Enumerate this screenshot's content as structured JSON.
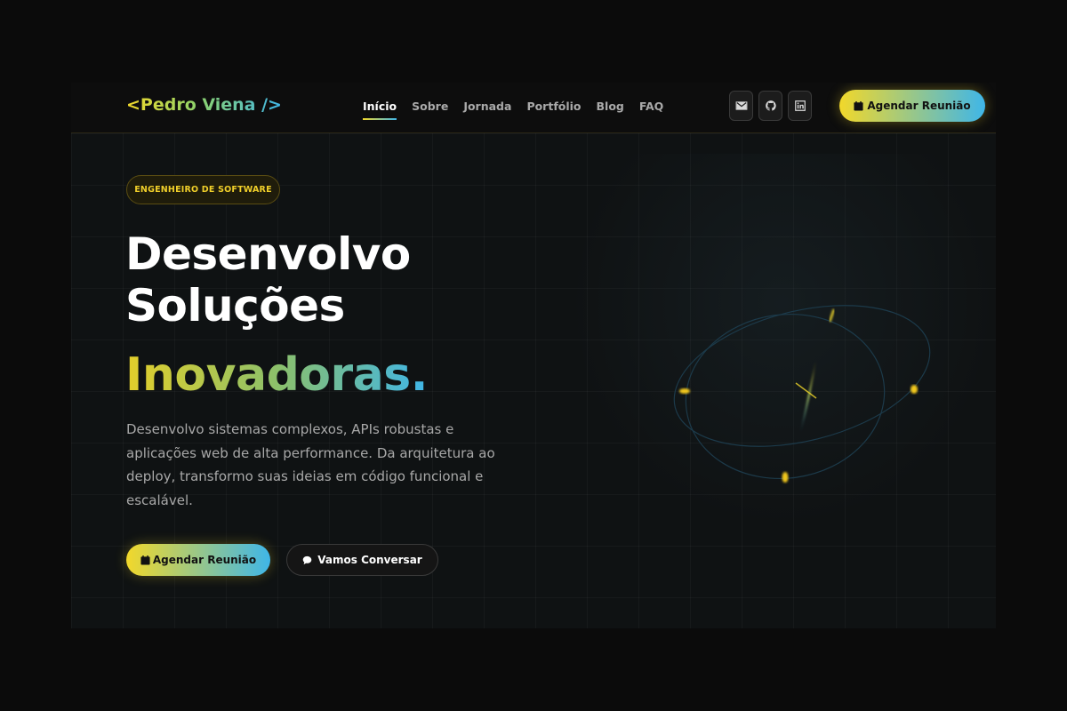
{
  "nav": {
    "logo": "<Pedro Viena />",
    "menu": [
      {
        "label": "Início",
        "active": true
      },
      {
        "label": "Sobre",
        "active": false
      },
      {
        "label": "Jornada",
        "active": false
      },
      {
        "label": "Portfólio",
        "active": false
      },
      {
        "label": "Blog",
        "active": false
      },
      {
        "label": "FAQ",
        "active": false
      }
    ],
    "social": [
      "mail-icon",
      "github-icon",
      "linkedin-icon"
    ],
    "cta_label": "Agendar Reunião"
  },
  "hero": {
    "badge": "ENGENHEIRO DE SOFTWARE",
    "title_line1": "Desenvolvo",
    "title_line2": "Soluções",
    "title_accent": "Inovadoras.",
    "description": "Desenvolvo sistemas complexos, APIs robustas e aplicações web de alta performance. Da arquitetura ao deploy, transformo suas ideias em código funcional e escalável.",
    "primary_label": "Agendar Reunião",
    "secondary_label": "Vamos Conversar"
  },
  "colors": {
    "accent_yellow": "#f2d82a",
    "accent_blue": "#3fb6e8",
    "background": "#0e0f10"
  }
}
